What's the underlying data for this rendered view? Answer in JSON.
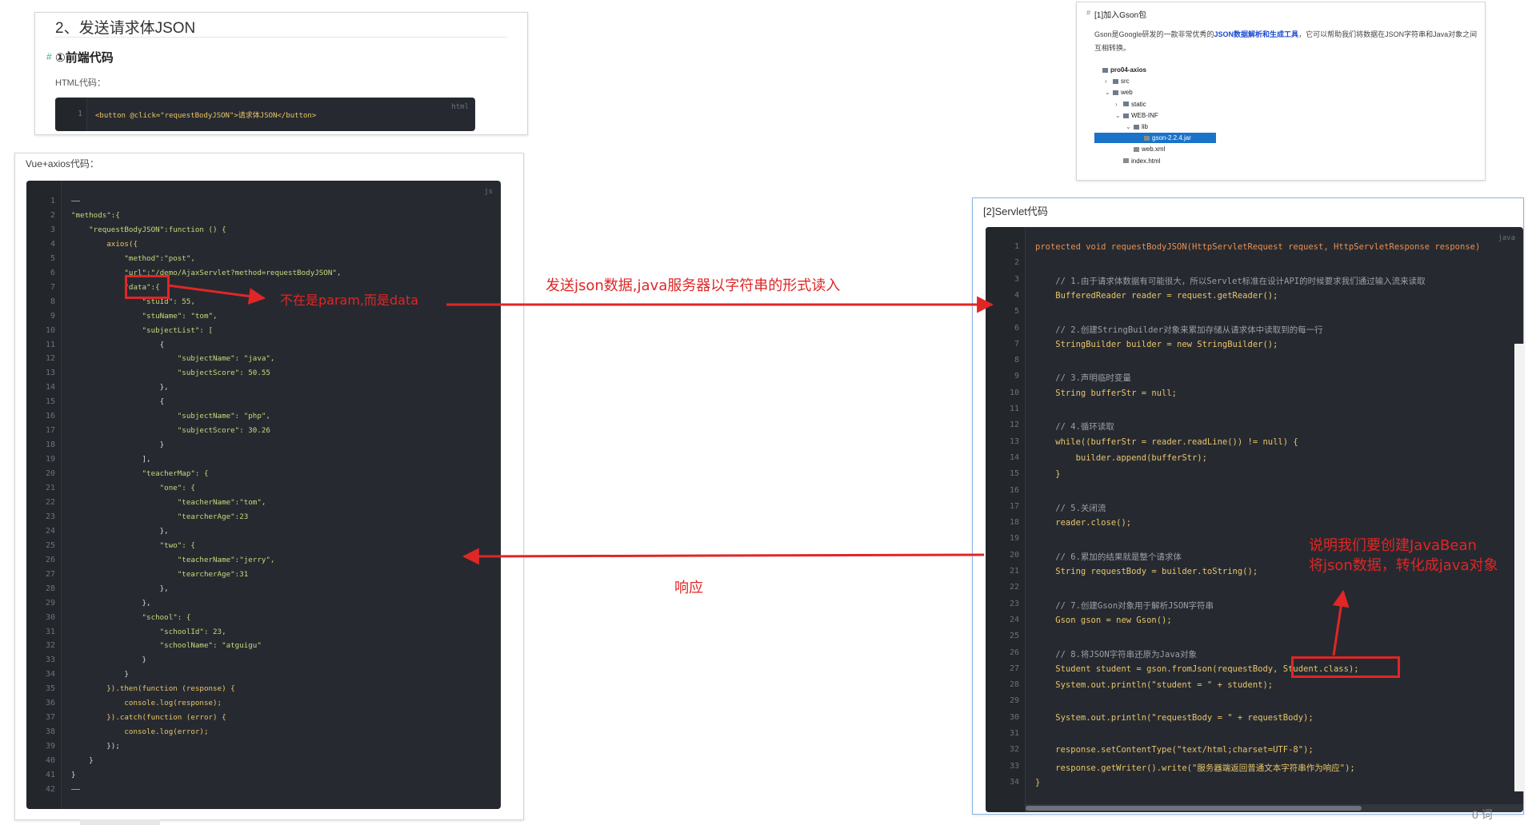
{
  "top_left": {
    "heading": "2、发送请求体JSON",
    "subheading": "①前端代码",
    "hash": "#",
    "html_label": "HTML代码：",
    "code_lang": "html",
    "line_no": "1",
    "code_line": "<button @click=\"requestBodyJSON\">请求体JSON</button>"
  },
  "vue": {
    "label": "Vue+axios代码：",
    "code_lang": "js",
    "lines": [
      "——",
      "\"methods\":{",
      "    \"requestBodyJSON\":function () {",
      "        axios({",
      "            \"method\":\"post\",",
      "            \"url\":\"/demo/AjaxServlet?method=requestBodyJSON\",",
      "            \"data\":{",
      "                \"stuId\": 55,",
      "                \"stuName\": \"tom\",",
      "                \"subjectList\": [",
      "                    {",
      "                        \"subjectName\": \"java\",",
      "                        \"subjectScore\": 50.55",
      "                    },",
      "                    {",
      "                        \"subjectName\": \"php\",",
      "                        \"subjectScore\": 30.26",
      "                    }",
      "                ],",
      "                \"teacherMap\": {",
      "                    \"one\": {",
      "                        \"teacherName\":\"tom\",",
      "                        \"tearcherAge\":23",
      "                    },",
      "                    \"two\": {",
      "                        \"teacherName\":\"jerry\",",
      "                        \"tearcherAge\":31",
      "                    },",
      "                },",
      "                \"school\": {",
      "                    \"schoolId\": 23,",
      "                    \"schoolName\": \"atguigu\"",
      "                }",
      "            }",
      "        }).then(function (response) {",
      "            console.log(response);",
      "        }).catch(function (error) {",
      "            console.log(error);",
      "        });",
      "    }",
      "}",
      "——"
    ]
  },
  "gson": {
    "title": "[1]加入Gson包",
    "hash": "#",
    "desc_before": "Gson是Google研发的一款非常优秀的",
    "desc_bold": "JSON数据解析和生成工具",
    "desc_after": "，它可以帮助我们将数据在JSON字符串和Java对象之间互相转换。",
    "tree": [
      {
        "label": "pro04-axios",
        "level": 0,
        "arrow": ""
      },
      {
        "label": "src",
        "level": 1,
        "arrow": "›"
      },
      {
        "label": "web",
        "level": 1,
        "arrow": "⌄"
      },
      {
        "label": "static",
        "level": 2,
        "arrow": "›"
      },
      {
        "label": "WEB-INF",
        "level": 2,
        "arrow": "⌄"
      },
      {
        "label": "lib",
        "level": 3,
        "arrow": "⌄"
      },
      {
        "label": "gson-2.2.4.jar",
        "level": 4,
        "arrow": ""
      },
      {
        "label": "web.xml",
        "level": 3,
        "arrow": ""
      },
      {
        "label": "index.html",
        "level": 2,
        "arrow": ""
      }
    ]
  },
  "servlet": {
    "title": "[2]Servlet代码",
    "code_lang": "java",
    "lines": [
      "protected void requestBodyJSON(HttpServletRequest request, HttpServletResponse response)",
      "",
      "    // 1.由于请求体数据有可能很大，所以Servlet标准在设计API的时候要求我们通过输入流来读取",
      "    BufferedReader reader = request.getReader();",
      "",
      "    // 2.创建StringBuilder对象来累加存储从请求体中读取到的每一行",
      "    StringBuilder builder = new StringBuilder();",
      "",
      "    // 3.声明临时变量",
      "    String bufferStr = null;",
      "",
      "    // 4.循环读取",
      "    while((bufferStr = reader.readLine()) != null) {",
      "        builder.append(bufferStr);",
      "    }",
      "",
      "    // 5.关闭流",
      "    reader.close();",
      "",
      "    // 6.累加的结果就是整个请求体",
      "    String requestBody = builder.toString();",
      "",
      "    // 7.创建Gson对象用于解析JSON字符串",
      "    Gson gson = new Gson();",
      "",
      "    // 8.将JSON字符串还原为Java对象",
      "    Student student = gson.fromJson(requestBody, Student.class);",
      "    System.out.println(\"student = \" + student);",
      "",
      "    System.out.println(\"requestBody = \" + requestBody);",
      "",
      "    response.setContentType(\"text/html;charset=UTF-8\");",
      "    response.getWriter().write(\"服务器端返回普通文本字符串作为响应\");",
      "}"
    ]
  },
  "annotations": {
    "not_param": "不在是param,而是data",
    "send_json": "发送json数据,java服务器以字符串的形式读入",
    "response": "响应",
    "javabean_line1": "说明我们要创建JavaBean",
    "javabean_line2": "将json数据，转化成java对象"
  },
  "footer_text": "0 词",
  "colors": {
    "accent": "#e02626",
    "code_bg": "#262a30",
    "selection": "#1a73c9"
  }
}
